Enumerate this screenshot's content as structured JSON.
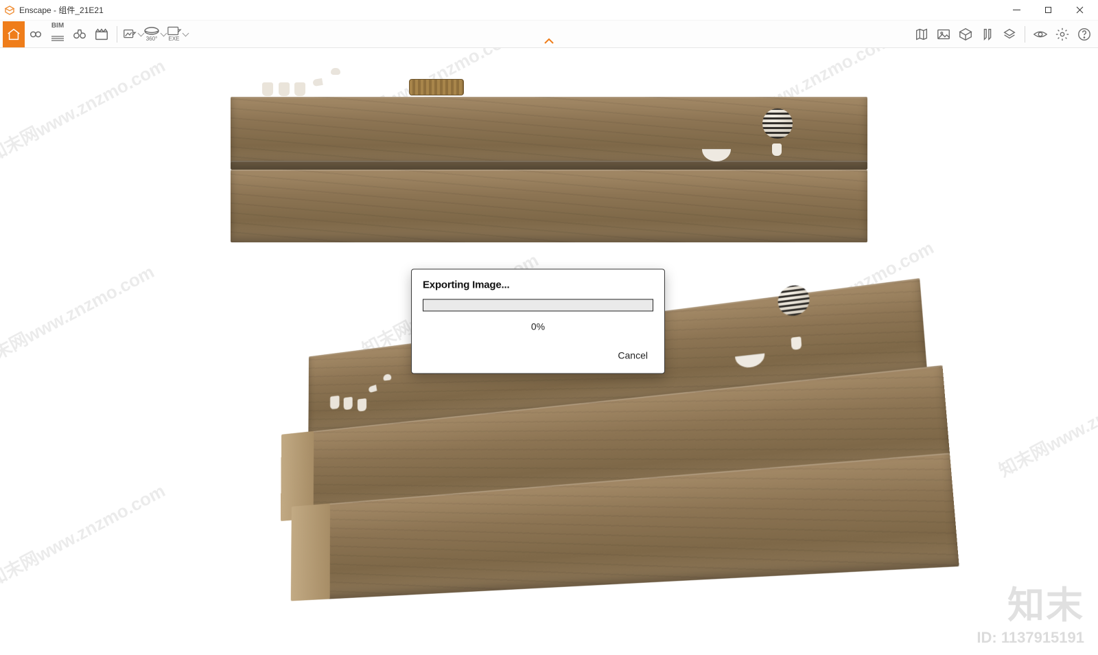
{
  "window": {
    "app_name": "Enscape",
    "title": "Enscape - 组件_21E21"
  },
  "win_controls": {
    "minimize_tip": "Minimize",
    "maximize_tip": "Maximize",
    "close_tip": "Close"
  },
  "toolbar": {
    "left_items": [
      {
        "name": "home",
        "active": true,
        "has_dropdown": false
      },
      {
        "name": "link",
        "active": false,
        "has_dropdown": false
      },
      {
        "name": "bim",
        "label": "BIM",
        "active": false,
        "has_dropdown": false
      },
      {
        "name": "binoculars",
        "active": false,
        "has_dropdown": false
      },
      {
        "name": "clapperboard",
        "active": false,
        "has_dropdown": false
      },
      {
        "name": "export-screenshot",
        "active": false,
        "has_dropdown": true
      },
      {
        "name": "export-360",
        "label": "360°",
        "active": false,
        "has_dropdown": true
      },
      {
        "name": "export-exe",
        "label": "EXE",
        "active": false,
        "has_dropdown": true
      }
    ],
    "right_items": [
      {
        "name": "map"
      },
      {
        "name": "gallery"
      },
      {
        "name": "box3d"
      },
      {
        "name": "bookmark"
      },
      {
        "name": "layers"
      },
      {
        "name": "visibility"
      },
      {
        "name": "settings"
      },
      {
        "name": "help"
      }
    ]
  },
  "export_dialog": {
    "title": "Exporting Image...",
    "progress_percent": 0,
    "progress_label": "0%",
    "cancel_label": "Cancel"
  },
  "watermark": {
    "repeat_text": "知末网www.znzmo.com",
    "corner_big": "知末",
    "id_label": "ID: 1137915191"
  },
  "scene": {
    "description": "Two rustic wooden beam shelves with ceramic teapot, cups, woven basket, bowl and striped spherical sculpture",
    "objects": [
      "teapot",
      "cups",
      "basket",
      "bowl",
      "striped-sphere"
    ]
  },
  "colors": {
    "accent": "#ef7d1a",
    "toolbar_bg": "#fdfdfd",
    "wood": "#8c7453"
  }
}
